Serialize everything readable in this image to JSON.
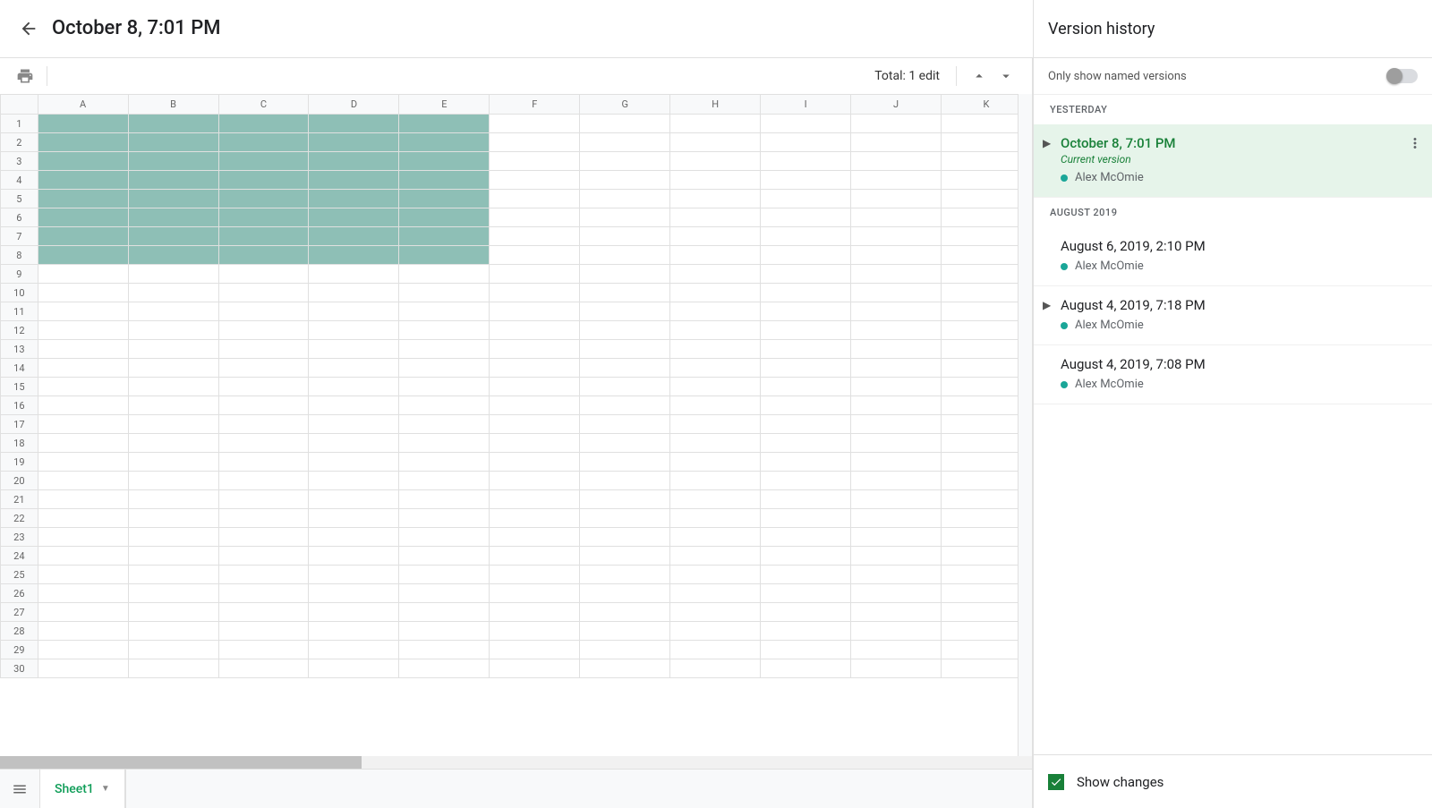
{
  "header": {
    "title": "October 8, 7:01 PM"
  },
  "toolbar": {
    "total_edits": "Total: 1 edit"
  },
  "columns": [
    "A",
    "B",
    "C",
    "D",
    "E",
    "F",
    "G",
    "H",
    "I",
    "J",
    "K"
  ],
  "row_count": 30,
  "highlight": {
    "cols": 5,
    "rows": 8
  },
  "sheet_tab": {
    "name": "Sheet1"
  },
  "sidebar": {
    "title": "Version history",
    "only_named_label": "Only show named versions",
    "groups": [
      {
        "label": "YESTERDAY",
        "versions": [
          {
            "title": "October 8, 7:01 PM",
            "subtitle": "Current version",
            "editor": "Alex McOmie",
            "selected": true,
            "expandable": true,
            "show_more": true
          }
        ]
      },
      {
        "label": "AUGUST 2019",
        "versions": [
          {
            "title": "August 6, 2019, 2:10 PM",
            "editor": "Alex McOmie",
            "expandable": false
          },
          {
            "title": "August 4, 2019, 7:18 PM",
            "editor": "Alex McOmie",
            "expandable": true
          },
          {
            "title": "August 4, 2019, 7:08 PM",
            "editor": "Alex McOmie",
            "expandable": false
          }
        ]
      }
    ],
    "show_changes_label": "Show changes"
  }
}
